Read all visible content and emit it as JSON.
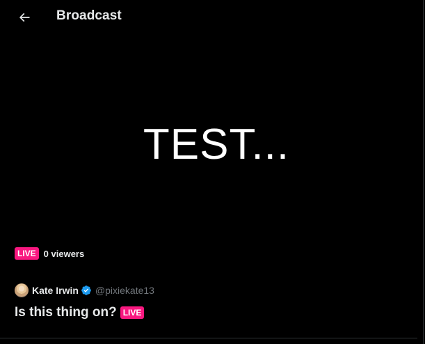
{
  "header": {
    "back_icon": "arrow-left-icon",
    "title": "Broadcast"
  },
  "video": {
    "overlay_text": "TEST..."
  },
  "status": {
    "live_label": "LIVE",
    "viewers": "0 viewers",
    "live_color": "#f91880"
  },
  "author": {
    "name": "Kate Irwin",
    "handle": "@pixiekate13",
    "verified_icon": "verified-badge-icon",
    "verified_color": "#1d9bf0"
  },
  "post": {
    "title": "Is this thing on?",
    "live_label": "LIVE"
  }
}
